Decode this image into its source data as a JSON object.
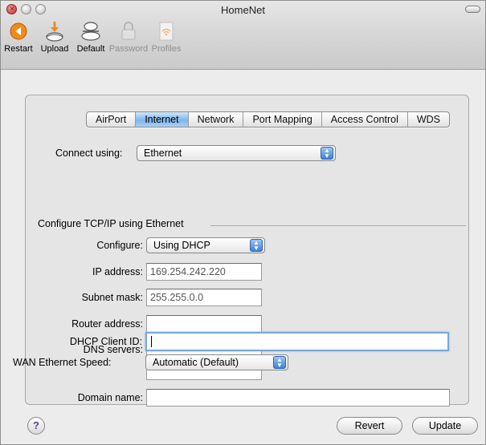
{
  "window": {
    "title": "HomeNet"
  },
  "toolbar": {
    "items": [
      {
        "label": "Restart",
        "icon": "restart-icon",
        "enabled": true
      },
      {
        "label": "Upload",
        "icon": "upload-icon",
        "enabled": true
      },
      {
        "label": "Default",
        "icon": "default-icon",
        "enabled": true
      },
      {
        "label": "Password",
        "icon": "lock-icon",
        "enabled": false
      },
      {
        "label": "Profiles",
        "icon": "profiles-icon",
        "enabled": false
      }
    ]
  },
  "tabs": [
    {
      "label": "AirPort",
      "active": false
    },
    {
      "label": "Internet",
      "active": true
    },
    {
      "label": "Network",
      "active": false
    },
    {
      "label": "Port Mapping",
      "active": false
    },
    {
      "label": "Access Control",
      "active": false
    },
    {
      "label": "WDS",
      "active": false
    }
  ],
  "form": {
    "connect_using_label": "Connect using:",
    "connect_using_value": "Ethernet",
    "group_title": "Configure TCP/IP using Ethernet",
    "configure_label": "Configure:",
    "configure_value": "Using DHCP",
    "ip_label": "IP address:",
    "ip_value": "169.254.242.220",
    "subnet_label": "Subnet mask:",
    "subnet_value": "255.255.0.0",
    "router_label": "Router address:",
    "router_value": "",
    "dns_label": "DNS servers:",
    "dns_values": [
      "",
      ""
    ],
    "domain_label": "Domain name:",
    "domain_value": "",
    "dhcp_label": "DHCP Client ID:",
    "dhcp_value": "",
    "wan_label": "WAN Ethernet Speed:",
    "wan_value": "Automatic (Default)"
  },
  "buttons": {
    "help": "?",
    "revert": "Revert",
    "update": "Update"
  },
  "colors": {
    "accent": "#7fb6ec",
    "popup_arrow": "#3d82d6",
    "close_button": "#d9534f",
    "restart_icon": "#f28a1a",
    "upload_arrow": "#f28a1a"
  }
}
